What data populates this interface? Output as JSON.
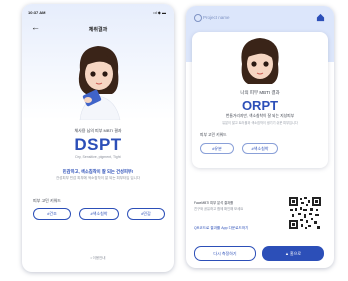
{
  "screen1": {
    "status_time": "10:37 AM",
    "status_icons": "•ıl ◆ ▬",
    "header_title": "체취결과",
    "caption": "체사용 님의 피부 MBTI 결과",
    "type_code": "DSPT",
    "type_sub": "Dry, Sensitive, pigment, Tight",
    "desc_highlight": "민감하고, 색소침착이 잘 되는 건성피부!",
    "desc_body": "건성피부 민감 피부에 색소침착이 잘 되는 피부타입 입니다",
    "keywords_label": "피부 고민 키워드",
    "keywords": [
      "#건조",
      "#색소침착",
      "#민감"
    ],
    "footer": "• 이용안내"
  },
  "screen2": {
    "brand": "Project name",
    "title": "나의 피부 MBTI 결과",
    "type_code": "ORPT",
    "desc": "번들거리지만, 색소침착이 잘 되는 지성피부",
    "desc_sub": "유분이 많고 트러블과 색소침착이 생기기 쉬운 피부입니다",
    "keywords_label": "피부 고민 키워드",
    "keywords": [
      "#유분",
      "#색소침착"
    ],
    "qr_text1": "FaceMBTI 피부 분석 결과를",
    "qr_text2": "친구와 공유하고 함께 확인해 보세요",
    "link_text": "QR코드로 결과를 App 다운로드하기",
    "btn_retry": "다시 측정하기",
    "btn_home": "홈으로"
  },
  "colors": {
    "accent": "#2c4fb8",
    "pink": "#e8467a",
    "header_bg": "#dce6fb"
  }
}
